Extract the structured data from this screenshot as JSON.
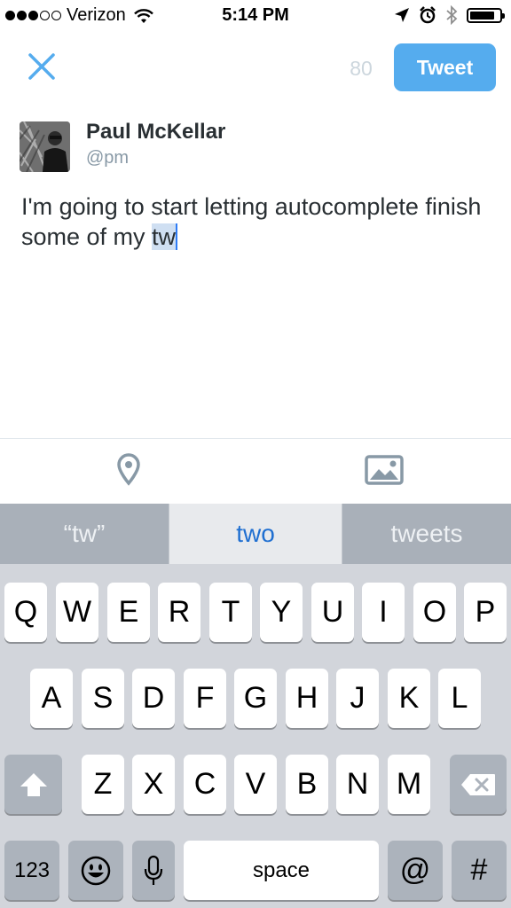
{
  "status_bar": {
    "signal_bars_filled": 3,
    "signal_bars_total": 5,
    "carrier": "Verizon",
    "time": "5:14 PM",
    "icons": [
      "wifi-icon",
      "location-arrow-icon",
      "alarm-icon",
      "bluetooth-icon",
      "battery-icon"
    ],
    "battery_level": 0.85
  },
  "compose": {
    "close_icon": "close-icon",
    "char_count": "80",
    "tweet_label": "Tweet"
  },
  "author": {
    "display_name": "Paul McKellar",
    "handle": "@pm"
  },
  "tweet": {
    "text_before": "I'm going to start letting autocomplete finish some of my ",
    "selected_text": "tw"
  },
  "toolbar": {
    "icons": [
      "location-pin-icon",
      "photo-icon"
    ]
  },
  "suggestions": {
    "left": "“tw”",
    "middle": "two",
    "right": "tweets"
  },
  "keyboard": {
    "row1": [
      "Q",
      "W",
      "E",
      "R",
      "T",
      "Y",
      "U",
      "I",
      "O",
      "P"
    ],
    "row2": [
      "A",
      "S",
      "D",
      "F",
      "G",
      "H",
      "J",
      "K",
      "L"
    ],
    "row3": [
      "Z",
      "X",
      "C",
      "V",
      "B",
      "N",
      "M"
    ],
    "numbers_key": "123",
    "space_key": "space",
    "at_key": "@",
    "hash_key": "#"
  },
  "colors": {
    "accent": "#55acee",
    "suggestion_highlight": "#1f6fd1",
    "keyboard_bg": "#d2d5db"
  }
}
